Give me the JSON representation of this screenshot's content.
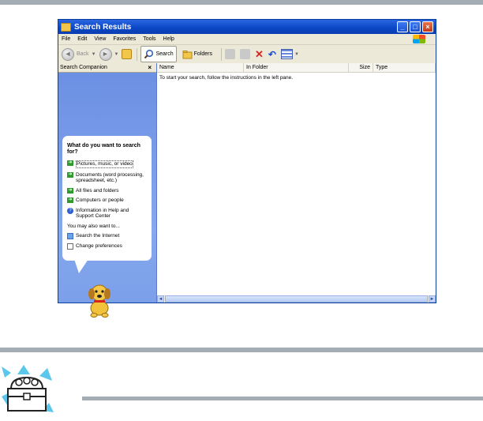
{
  "window": {
    "title": "Search Results",
    "menu": [
      "File",
      "Edit",
      "View",
      "Favorites",
      "Tools",
      "Help"
    ],
    "toolbar": {
      "back_label": "Back",
      "search_label": "Search",
      "folders_label": "Folders"
    }
  },
  "left_pane": {
    "header": "Search Companion",
    "close_glyph": "×",
    "question": "What do you want to search for?",
    "options": [
      "Pictures, music, or video",
      "Documents (word processing, spreadsheet, etc.)",
      "All files and folders",
      "Computers or people",
      "Information in Help and Support Center"
    ],
    "also_label": "You may also want to...",
    "also_options": [
      "Search the Internet",
      "Change preferences"
    ]
  },
  "right_pane": {
    "columns": [
      "Name",
      "In Folder",
      "Size",
      "Type"
    ],
    "message": "To start your search, follow the instructions in the left pane."
  }
}
